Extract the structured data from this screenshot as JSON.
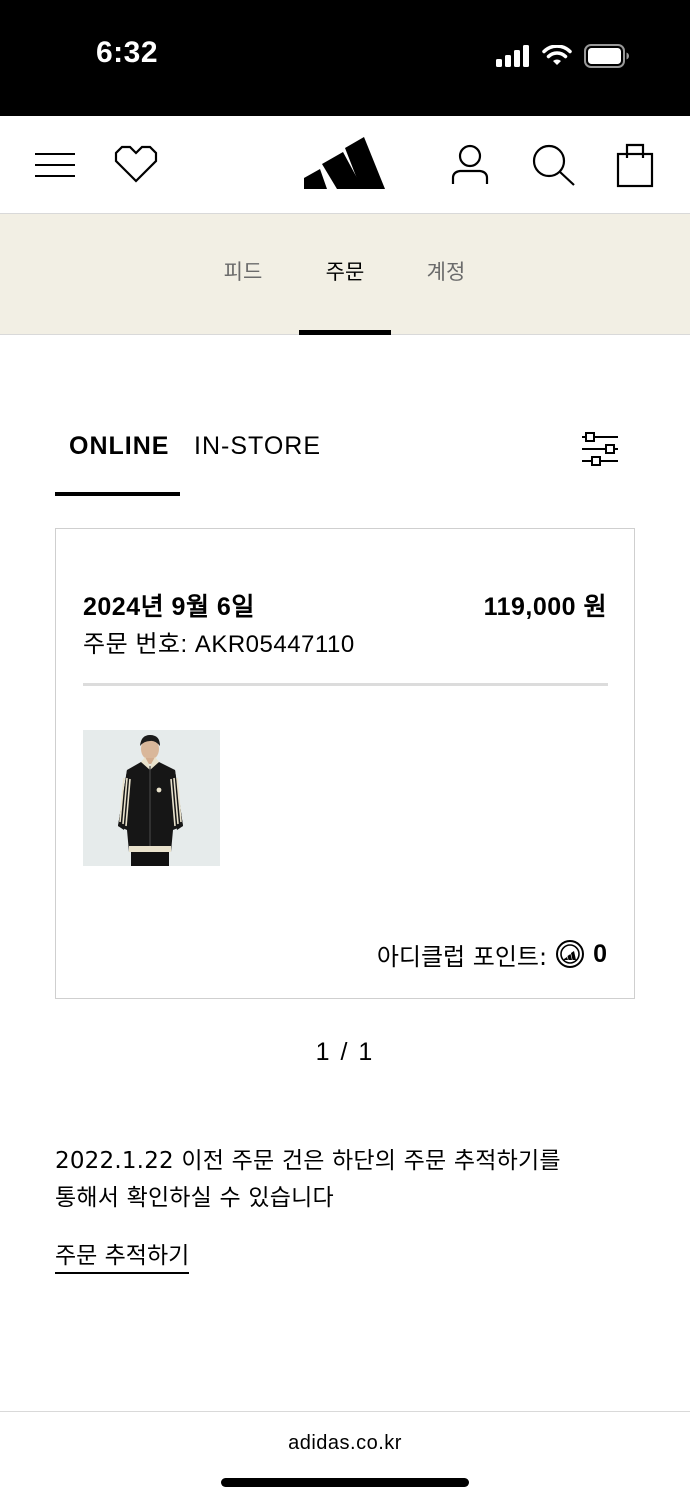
{
  "status_bar": {
    "time": "6:32",
    "icons": [
      "signal-icon",
      "wifi-icon",
      "battery-icon"
    ]
  },
  "header": {
    "icons": [
      "menu-icon",
      "heart-icon",
      "adidas-logo",
      "account-icon",
      "search-icon",
      "bag-icon"
    ]
  },
  "subnav": {
    "tabs": [
      {
        "label": "피드",
        "active": false
      },
      {
        "label": "주문",
        "active": true
      },
      {
        "label": "계정",
        "active": false
      }
    ]
  },
  "orders": {
    "tabs": [
      {
        "label": "ONLINE",
        "active": true
      },
      {
        "label": "IN-STORE",
        "active": false
      }
    ],
    "filter_icon": "filter-sliders-icon",
    "card": {
      "date": "2024년 9월 6일",
      "price": "119,000 원",
      "order_number": "주문 번호: AKR05447110",
      "product_image": "black track jacket with cream stripes",
      "points_label": "아디클럽 포인트:",
      "points_value": "0"
    },
    "pagination": "1 / 1"
  },
  "notice": {
    "line1": "2022.1.22 이전 주문 건은 하단의 주문 추적하기를",
    "line2": "통해서 확인하실 수 있습니다",
    "link_label": "주문 추적하기"
  },
  "browser": {
    "url": "adidas.co.kr"
  },
  "colors": {
    "subnav_bg": "#f2efe4",
    "accent": "#000000",
    "divider": "#dcdcdc"
  }
}
